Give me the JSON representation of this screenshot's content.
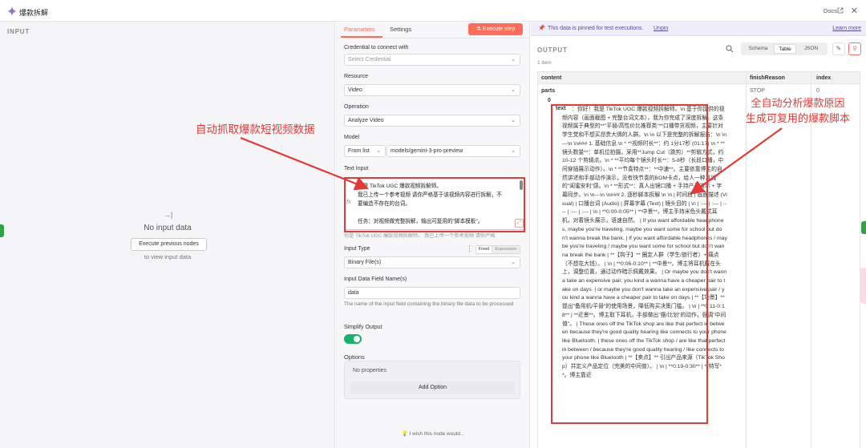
{
  "header": {
    "title": "爆款拆解",
    "docs_label": "Docs",
    "close": "✕"
  },
  "input_panel": {
    "label": "INPUT",
    "no_input_icon": "→|",
    "no_input_title": "No input data",
    "execute_previous": "Execute previous nodes",
    "to_view": "to view input data"
  },
  "params": {
    "tabs": [
      "Parameters",
      "Settings"
    ],
    "execute_step": "Execute step",
    "credential_label": "Credential to connect with",
    "credential_placeholder": "Select Credential",
    "resource_label": "Resource",
    "resource_value": "Video",
    "operation_label": "Operation",
    "operation_value": "Analyze Video",
    "model_label": "Model",
    "model_source": "From list",
    "model_value": "models/gemini-3-pro-preview",
    "text_input_label": "Text Input",
    "text_input_lines": [
      "你是 TikTok UGC 爆款视频拆解师。",
      "我已上传一个参考视频 请你严格基于该视频内容进行拆解，不",
      "要编造不存在的台词。",
      "",
      "任务：对视频做完整拆解，输出可复用的\"脚本模板\"。"
    ],
    "text_input_preview": "你是 TikTok UGC 爆款视频拆解师。 我已上传一个参考视频 请你严格",
    "input_type_label": "Input Type",
    "input_type_fixed": "Fixed",
    "input_type_expression": "Expression",
    "input_type_value": "Binary File(s)",
    "binary_field_label": "Input Data Field Name(s)",
    "binary_field_value": "data",
    "binary_field_hint": "The name of the input field containing the binary file data to be processed",
    "simplify_label": "Simplify Output",
    "options_label": "Options",
    "no_properties": "No properties",
    "add_option": "Add Option",
    "wish": "I wish this node would..."
  },
  "output": {
    "pinned_text": "This data is pinned for test executions.",
    "unpin": "Unpin",
    "learn_more": "Learn more",
    "label": "OUTPUT",
    "views": [
      "Schema",
      "Table",
      "JSON"
    ],
    "item_count": "1 item",
    "columns": [
      "content",
      "finishReason",
      "index"
    ],
    "parts_key": "parts",
    "finish_reason": "STOP",
    "index_value": "0",
    "part_index": "0",
    "text_key": "text",
    "text_value": "：你好！我是 TikTok UGC 爆款视频拆解师。\\n 基于你提供的视频内容（画面截图 + 完整台词文本），我为你完成了深度拆解。这条视频属于典型的**\"平替/高性价比推荐类\"**口播带货视频，主要针对学生党和不想买昂贵大牌的人群。\\n \\n 以下是完整的拆解报告：\\n \\n---\\n \\n### 1. 基础信息 \\n * **视频时长**：约 1分17秒 (01:17) \\n * **镜头数量**：单机位拍摄，采用**Jump Cut（跳剪）**剪辑方式，约 10-12 个剪辑点。\\n * **平均每个镜头时长**：5-8秒（长段口播，中间穿插展示动作）。\\n * **节奏特点**：**中速**。主要依靠博主的自然讲述和手部动作演示，没有快节奏的BGM卡点，给人一种真诚的\"闺蜜安利\"感。\\n * **形式**：真人出镜口播 + 手持产品演示 + 字幕同步。\\n \\n---\\n \\n### 2. 逐秒脚本拆解 \\n \\n | 时间段 | 画面描述 (Visual) | 口播台词 (Audio) | 屏幕字幕 (Text) | 镜头目的 | \\n | :--- | :--- | :--- | :--- | :--- | \\n | **0:00-0:05** | **中景**，博主手持米色头戴式耳机，对着镜头展示，语速自然。 | If you want affordable headphones, maybe you're traveling, maybe you want some for school but don't wanna break the bank. | If you want affordable headphones / maybe you're traveling / maybe you want some for school but don't wanna break the bank | **【钩子】** 圈定人群（学生/旅行者）+ 痛点（不想花大钱）。 | \\n | **0:06-0:10** | **中景**。博主将耳机戴在头上，调整位置，通过动作暗示佩戴效果。 | Or maybe you don't wanna take an expensive pair, you kind a wanna have a cheaper pair to take on days. | or maybe you don't wanna take an expensive pair / you kind a wanna have a cheaper pair to take on days | **【场景】** 提出\"备用机/平替\"的使用场景，降低购买决策门槛。 | \\n | **0:11-0:18** | **近景**。博主取下耳机，手部做出\"摆/比划\"的动作，强调\"中间值\"。 | These ones off the TikTok shop are like that perfect in between because they're good quality hearing like connects to your phone like Bluetooth. | these ones off the TikTok shop / are like that perfect in between / because they're good quality hearing / like connects to your phone like Bluetooth | **【卖点】** 引出产品来源（TikTok Shop）并定义产品定位（完美的中间值）。 | \\n | **0:19-0:30** | **特写**。博主靠近"
  },
  "annotations": {
    "left": "自动抓取爆款短视频数据",
    "right_line1": "全自动分析爆款原因",
    "right_line2": "生成可复用的爆款脚本"
  },
  "colors": {
    "accent": "#ff6d5a",
    "annotation_red": "#e53935",
    "toggle_on": "#13b36a",
    "pinned_bg": "#f1eefc"
  },
  "icons": {
    "logo": "gemini-sparkle-icon",
    "external": "external-link-icon",
    "search": "search-icon",
    "edit": "pencil-icon",
    "pin": "pin-icon"
  }
}
